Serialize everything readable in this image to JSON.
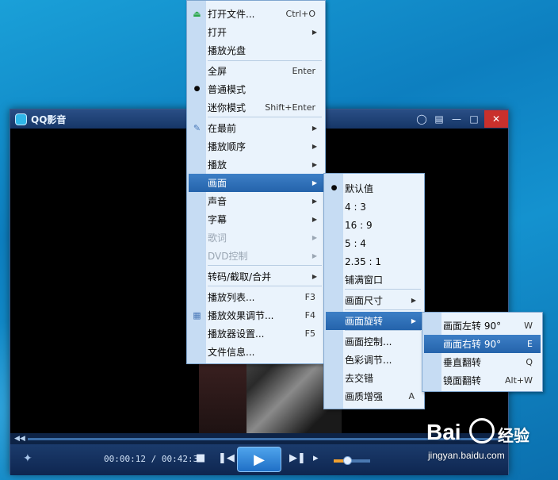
{
  "window": {
    "title": "QQ影音",
    "colors": {
      "titlebar": "#1e4378",
      "close": "#c9302c",
      "highlight": "#2f72ba"
    }
  },
  "player": {
    "time_current": "00:00:12",
    "time_total": "00:42:31",
    "time_separator": " / ",
    "volume_level": 0.38
  },
  "menu_main": [
    {
      "label": "打开文件...",
      "shortcut": "Ctrl+O",
      "icon": "eject-icon"
    },
    {
      "label": "打开",
      "submenu": true
    },
    {
      "label": "播放光盘"
    },
    {
      "label": "全屏",
      "shortcut": "Enter"
    },
    {
      "label": "普通模式",
      "checked": true
    },
    {
      "label": "迷你模式",
      "shortcut": "Shift+Enter"
    },
    {
      "label": "在最前",
      "submenu": true,
      "icon": "pin-icon"
    },
    {
      "label": "播放顺序",
      "submenu": true
    },
    {
      "label": "播放",
      "submenu": true
    },
    {
      "label": "画面",
      "submenu": true,
      "highlighted": true
    },
    {
      "label": "声音",
      "submenu": true
    },
    {
      "label": "字幕",
      "submenu": true
    },
    {
      "label": "歌词",
      "submenu": true,
      "disabled": true
    },
    {
      "label": "DVD控制",
      "submenu": true,
      "disabled": true
    },
    {
      "label": "转码/截取/合并",
      "submenu": true
    },
    {
      "label": "播放列表...",
      "shortcut": "F3"
    },
    {
      "label": "播放效果调节...",
      "shortcut": "F4",
      "icon": "equalizer-icon"
    },
    {
      "label": "播放器设置...",
      "shortcut": "F5"
    },
    {
      "label": "文件信息..."
    }
  ],
  "menu_picture": [
    {
      "label": "默认值",
      "checked": true
    },
    {
      "label": "4 : 3"
    },
    {
      "label": "16 : 9"
    },
    {
      "label": "5 : 4"
    },
    {
      "label": "2.35 : 1"
    },
    {
      "label": "铺满窗口"
    },
    {
      "label": "画面尺寸",
      "submenu": true
    },
    {
      "label": "画面旋转",
      "submenu": true,
      "highlighted": true
    },
    {
      "label": "画面控制..."
    },
    {
      "label": "色彩调节..."
    },
    {
      "label": "去交错"
    },
    {
      "label": "画质增强",
      "shortcut": "A"
    }
  ],
  "menu_rotate": [
    {
      "label": "画面左转 90°",
      "shortcut": "W"
    },
    {
      "label": "画面右转 90°",
      "shortcut": "E",
      "highlighted": true
    },
    {
      "label": "垂直翻转",
      "shortcut": "Q"
    },
    {
      "label": "镜面翻转",
      "shortcut": "Alt+W"
    }
  ],
  "watermark": {
    "brand_a": "Bai",
    "brand_b": "经验",
    "url": "jingyan.baidu.com"
  }
}
